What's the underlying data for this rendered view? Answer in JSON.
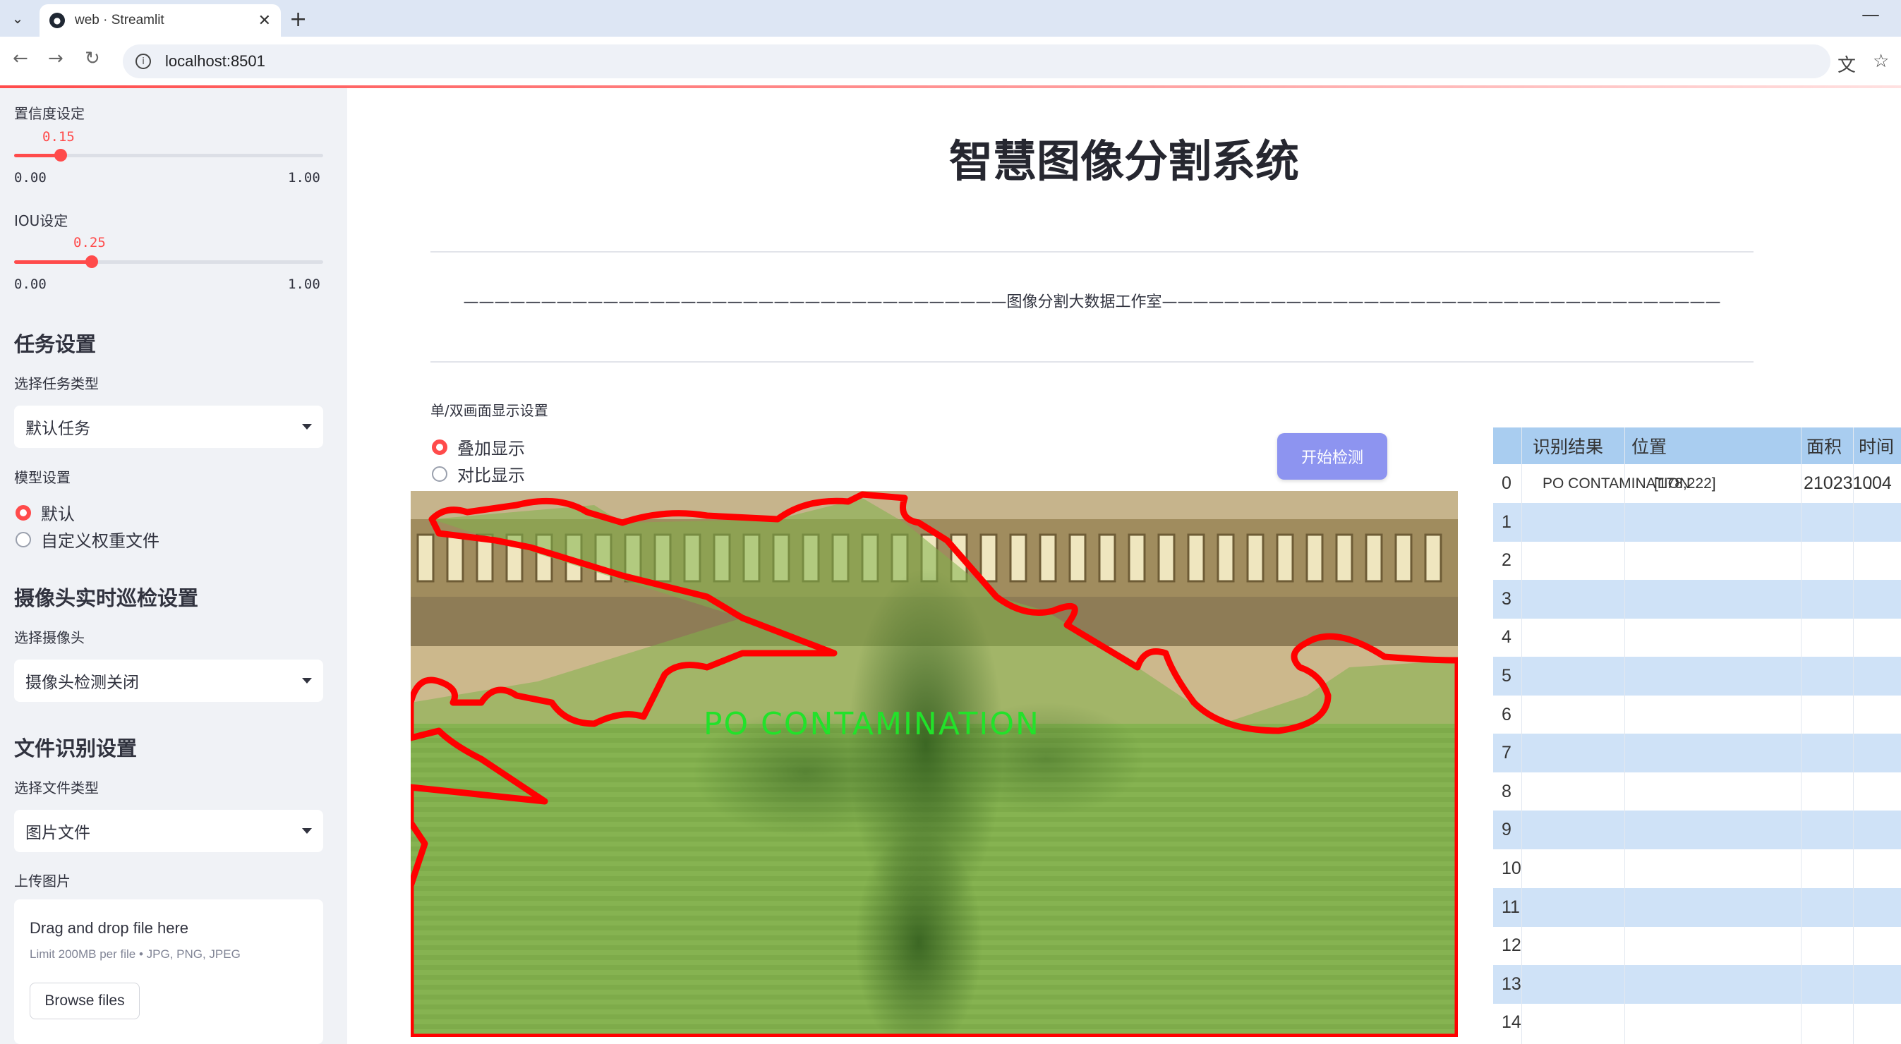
{
  "browser": {
    "tab_title": "web · Streamlit",
    "url": "localhost:8501"
  },
  "sidebar": {
    "confidence": {
      "label": "置信度设定",
      "value": "0.15",
      "min": "0.00",
      "max": "1.00",
      "level": 0.15
    },
    "iou": {
      "label": "IOU设定",
      "value": "0.25",
      "min": "0.00",
      "max": "1.00",
      "level": 0.25
    },
    "task_section": "任务设置",
    "task_type_label": "选择任务类型",
    "task_type_value": "默认任务",
    "model_label": "模型设置",
    "model_options": [
      "默认",
      "自定义权重文件"
    ],
    "model_selected": 0,
    "camera_section": "摄像头实时巡检设置",
    "camera_label": "选择摄像头",
    "camera_value": "摄像头检测关闭",
    "file_section": "文件识别设置",
    "file_type_label": "选择文件类型",
    "file_type_value": "图片文件",
    "upload_label": "上传图片",
    "uploader": {
      "title": "Drag and drop file here",
      "limit": "Limit 200MB per file • JPG, PNG, JPEG",
      "button": "Browse files"
    }
  },
  "main": {
    "title": "智慧图像分割系统",
    "divider_text": "———————————————————————————————————图像分割大数据工作室————————————————————————————————————",
    "display_label": "单/双画面显示设置",
    "display_options": [
      "叠加显示",
      "对比显示"
    ],
    "display_selected": 0,
    "start_button": "开始检测",
    "detection_label": "PO CONTAMINATION"
  },
  "table": {
    "columns": [
      "识别结果",
      "位置",
      "面积",
      "时间"
    ],
    "rows": [
      {
        "index": "0",
        "result": "PO CONTAMINATION",
        "position": "[178,222]",
        "area": "2102310",
        "time": ".04"
      },
      {
        "index": "1"
      },
      {
        "index": "2"
      },
      {
        "index": "3"
      },
      {
        "index": "4"
      },
      {
        "index": "5"
      },
      {
        "index": "6"
      },
      {
        "index": "7"
      },
      {
        "index": "8"
      },
      {
        "index": "9"
      },
      {
        "index": "10"
      },
      {
        "index": "11"
      },
      {
        "index": "12"
      },
      {
        "index": "13"
      },
      {
        "index": "14"
      }
    ]
  },
  "colors": {
    "accent": "#ff4b4b",
    "button": "#8d94f0",
    "table_header": "#a9cdf0",
    "table_alt_row": "#cfe2f7"
  }
}
